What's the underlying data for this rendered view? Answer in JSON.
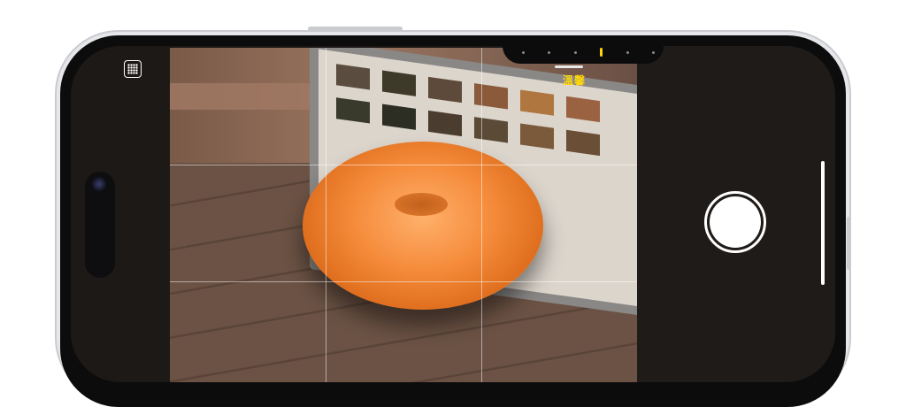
{
  "camera": {
    "style_label": "溫馨",
    "style_dial_ticks": 6,
    "selected_style_index": 3
  },
  "colors": {
    "accent_yellow": "#ffd60a",
    "shutter_white": "#ffffff",
    "device_silver": "#e6e7ea"
  },
  "icons": {
    "grid_toggle": "grid-toggle-icon",
    "shutter": "shutter-button-icon",
    "front_camera": "front-camera-icon"
  }
}
